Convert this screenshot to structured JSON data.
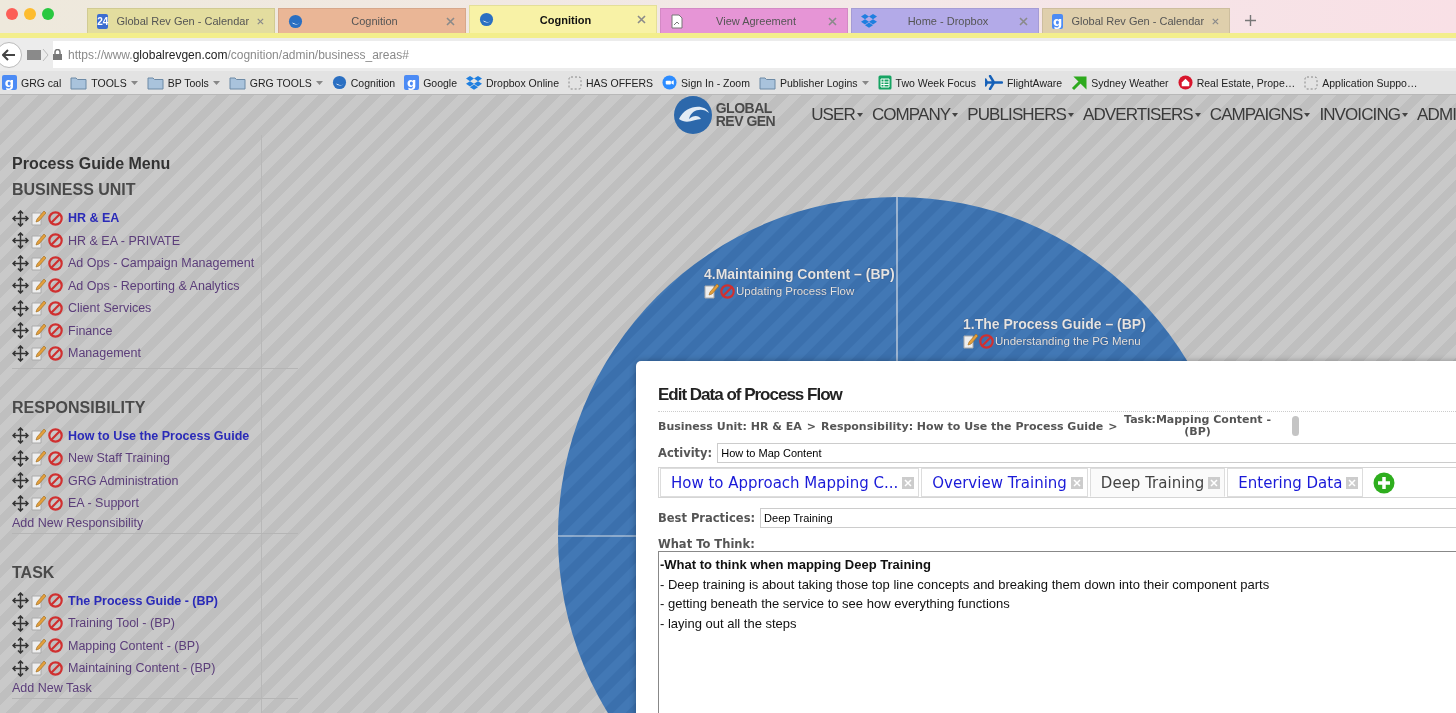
{
  "browser": {
    "tabs": [
      {
        "title": "Global Rev Gen - Calendar",
        "kind": "calendar",
        "icon_text": "24",
        "color": "#e3dd9f",
        "selected": false
      },
      {
        "title": "Cognition",
        "kind": "globe",
        "color": "#eab696",
        "selected": false
      },
      {
        "title": "Cognition",
        "kind": "globe",
        "color": "#f8f2a6",
        "selected": true
      },
      {
        "title": "View Agreement",
        "kind": "document",
        "color": "#e695d6",
        "selected": false
      },
      {
        "title": "Home - Dropbox",
        "kind": "dropbox",
        "color": "#b3aae8",
        "selected": false
      },
      {
        "title": "Global Rev Gen - Calendar",
        "kind": "google",
        "icon_text": "g",
        "color": "#dfcfac",
        "selected": false
      }
    ],
    "url": {
      "scheme": "https://www.",
      "domain": "globalrevgen.com",
      "path": "/cognition/admin/business_areas#"
    },
    "bookmarks": [
      {
        "label": "GRG cal",
        "kind": "google",
        "icon_text": "g"
      },
      {
        "label": "TOOLS",
        "kind": "folder"
      },
      {
        "label": "BP Tools",
        "kind": "folder"
      },
      {
        "label": "GRG TOOLS",
        "kind": "folder"
      },
      {
        "label": "Cognition",
        "kind": "globe"
      },
      {
        "label": "Google",
        "kind": "google",
        "icon_text": "g"
      },
      {
        "label": "Dropbox Online",
        "kind": "dropbox"
      },
      {
        "label": "HAS OFFERS",
        "kind": "blank"
      },
      {
        "label": "Sign In - Zoom",
        "kind": "zoom"
      },
      {
        "label": "Publisher Logins",
        "kind": "folder"
      },
      {
        "label": "Two Week Focus",
        "kind": "sheet"
      },
      {
        "label": "FlightAware",
        "kind": "plane"
      },
      {
        "label": "Sydney Weather",
        "kind": "arrow"
      },
      {
        "label": "Real Estate, Prope…",
        "kind": "house"
      },
      {
        "label": "Application Suppo…",
        "kind": "blank"
      }
    ]
  },
  "header": {
    "logo": {
      "line1": "GLOBAL",
      "line2": "REV GEN"
    },
    "nav": [
      {
        "label": "USER",
        "dropdown": true
      },
      {
        "label": "COMPANY",
        "dropdown": true
      },
      {
        "label": "PUBLISHERS",
        "dropdown": true
      },
      {
        "label": "ADVERTISERS",
        "dropdown": true
      },
      {
        "label": "CAMPAIGNS",
        "dropdown": true
      },
      {
        "label": "INVOICING",
        "dropdown": true
      },
      {
        "label": "ADMI",
        "dropdown": false
      }
    ]
  },
  "sidebar": {
    "title": "Process Guide Menu",
    "sections": [
      {
        "heading": "BUSINESS UNIT",
        "items": [
          {
            "label": "HR & EA",
            "selected": true
          },
          {
            "label": "HR & EA - PRIVATE",
            "selected": false
          },
          {
            "label": "Ad Ops - Campaign Management",
            "selected": false
          },
          {
            "label": "Ad Ops - Reporting & Analytics",
            "selected": false
          },
          {
            "label": "Client Services",
            "selected": false
          },
          {
            "label": "Finance",
            "selected": false
          },
          {
            "label": "Management",
            "selected": false
          }
        ]
      },
      {
        "heading": "RESPONSIBILITY",
        "items": [
          {
            "label": "How to Use the Process Guide",
            "selected": true
          },
          {
            "label": "New Staff Training",
            "selected": false
          },
          {
            "label": "GRG Administration",
            "selected": false
          },
          {
            "label": "EA - Support",
            "selected": false
          }
        ],
        "add_link": "Add New Responsibility"
      },
      {
        "heading": "TASK",
        "items": [
          {
            "label": "The Process Guide - (BP)",
            "selected": true
          },
          {
            "label": "Training Tool - (BP)",
            "selected": false
          },
          {
            "label": "Mapping Content - (BP)",
            "selected": false
          },
          {
            "label": "Maintaining Content - (BP)",
            "selected": false
          }
        ],
        "add_link": "Add New Task"
      }
    ]
  },
  "diagram": {
    "sections": [
      {
        "title": "4.Maintaining Content – (BP)",
        "items": [
          "Updating Process Flow"
        ]
      },
      {
        "title": "1.The Process Guide – (BP)",
        "items": [
          "Understanding the PG Menu"
        ]
      }
    ]
  },
  "modal": {
    "title": "Edit Data of Process Flow",
    "breadcrumb": [
      {
        "text": "Business Unit: HR & EA"
      },
      {
        "text": ">"
      },
      {
        "text": "Responsibility: How to Use the Process Guide"
      },
      {
        "text": ">"
      },
      {
        "text": "Task:Mapping Content - (BP)"
      }
    ],
    "activity": {
      "label": "Activity:",
      "value": "How to Map Content"
    },
    "tabs": [
      {
        "label": "How to Approach Mapping C...",
        "selected": false
      },
      {
        "label": "Overview Training",
        "selected": false
      },
      {
        "label": "Deep Training",
        "selected": true
      },
      {
        "label": "Entering Data",
        "selected": false
      }
    ],
    "best_practices": {
      "label": "Best Practices:",
      "value": "Deep Training"
    },
    "what_to_think": {
      "label": "What To Think:",
      "lines": [
        {
          "kind": "heading",
          "text": "-What to think when mapping Deep Training"
        },
        {
          "kind": "line",
          "text": "- Deep training is about taking those top line concepts and breaking them down into their component parts"
        },
        {
          "kind": "line",
          "text": "- getting beneath the service to see how everything functions"
        },
        {
          "kind": "line",
          "text": "- laying out all the steps"
        }
      ]
    }
  }
}
